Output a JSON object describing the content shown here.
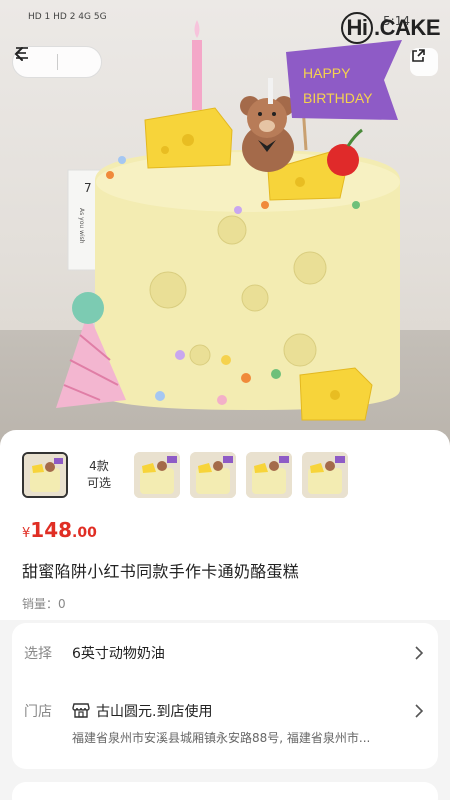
{
  "status_bar": {
    "left_text": "HD 1  HD 2  4G  5G",
    "right_text": "5:14"
  },
  "brand": {
    "hi": "Hi",
    "suffix": ".CAKE"
  },
  "cake_image": {
    "box_number": "7",
    "box_text": "As you wish",
    "banner_line1": "HAPPY",
    "banner_line2": "BIRTHDAY"
  },
  "variants": {
    "count_label": "4款",
    "count_sub": "可选"
  },
  "product": {
    "currency": "¥",
    "price_int": "148",
    "price_dec": ".00",
    "title": "甜蜜陷阱小红书同款手作卡通奶酪蛋糕",
    "sales": "销量：0"
  },
  "options": {
    "select_label": "选择",
    "select_value": "6英寸动物奶油",
    "store_label": "门店",
    "store_name": "古山圆元.到店使用",
    "store_address": "福建省泉州市安溪县城厢镇永安路88号, 福建省泉州市..."
  },
  "colors": {
    "price": "#e02e24",
    "accent_banner": "#8e5bc6",
    "cake": "#f3ebb0"
  }
}
